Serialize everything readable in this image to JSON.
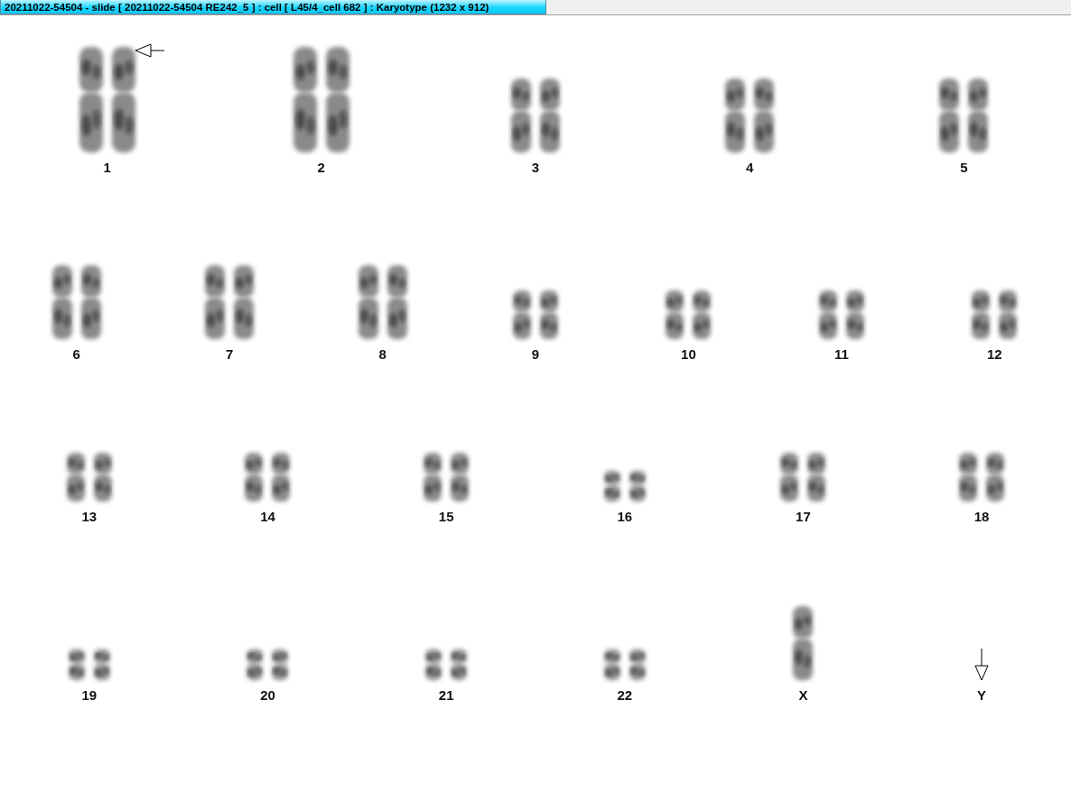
{
  "window": {
    "title": "20211022-54504 - slide [ 20211022-54504 RE242_5 ] : cell [ L45/4_cell 682 ] : Karyotype  (1232 x 912)"
  },
  "karyotype": {
    "rows": [
      {
        "items": [
          {
            "label": "1",
            "kind": "pair",
            "flagged": true
          },
          {
            "label": "2",
            "kind": "pair",
            "flagged": false
          },
          {
            "label": "3",
            "kind": "pair",
            "flagged": false
          },
          {
            "label": "4",
            "kind": "pair",
            "flagged": false
          },
          {
            "label": "5",
            "kind": "pair",
            "flagged": false
          }
        ]
      },
      {
        "items": [
          {
            "label": "6",
            "kind": "pair",
            "flagged": false
          },
          {
            "label": "7",
            "kind": "pair",
            "flagged": false
          },
          {
            "label": "8",
            "kind": "pair",
            "flagged": false
          },
          {
            "label": "9",
            "kind": "pair",
            "flagged": false
          },
          {
            "label": "10",
            "kind": "pair",
            "flagged": false
          },
          {
            "label": "11",
            "kind": "pair",
            "flagged": false
          },
          {
            "label": "12",
            "kind": "pair",
            "flagged": false
          }
        ]
      },
      {
        "items": [
          {
            "label": "13",
            "kind": "pair",
            "flagged": false
          },
          {
            "label": "14",
            "kind": "pair",
            "flagged": false
          },
          {
            "label": "15",
            "kind": "pair",
            "flagged": false
          },
          {
            "label": "16",
            "kind": "pair",
            "flagged": false
          },
          {
            "label": "17",
            "kind": "pair",
            "flagged": false
          },
          {
            "label": "18",
            "kind": "pair",
            "flagged": false
          }
        ]
      },
      {
        "items": [
          {
            "label": "19",
            "kind": "pair",
            "flagged": false
          },
          {
            "label": "20",
            "kind": "pair",
            "flagged": false
          },
          {
            "label": "21",
            "kind": "pair",
            "flagged": false
          },
          {
            "label": "22",
            "kind": "pair",
            "flagged": false
          },
          {
            "label": "X",
            "kind": "single",
            "flagged": false
          },
          {
            "label": "Y",
            "kind": "missing",
            "flagged": true
          }
        ]
      }
    ]
  }
}
